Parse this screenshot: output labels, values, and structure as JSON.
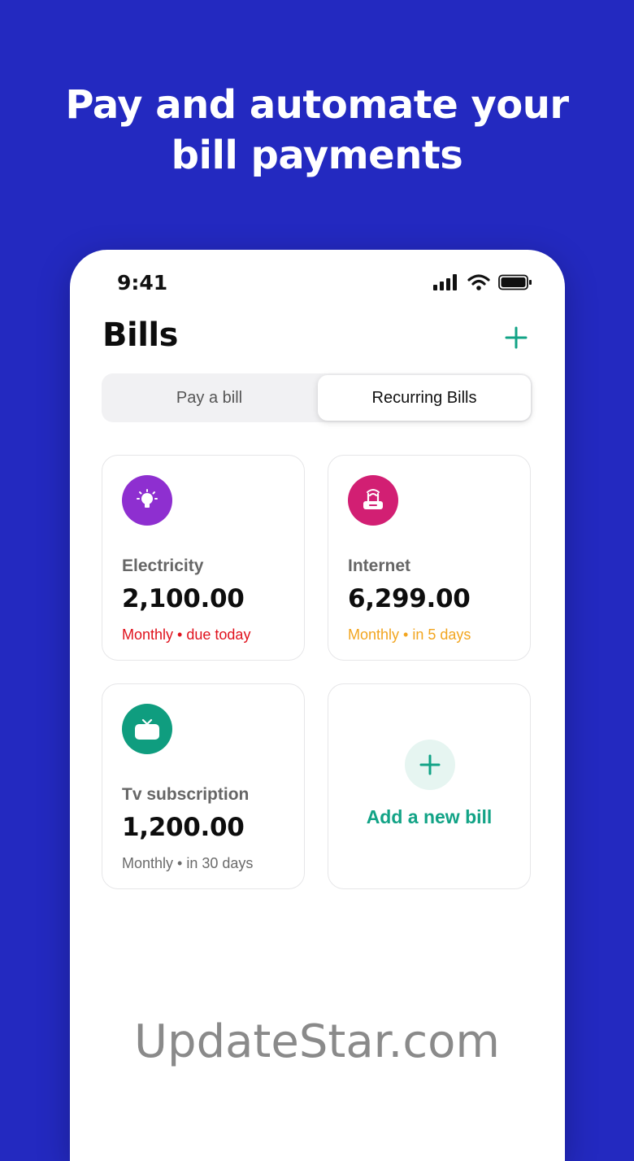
{
  "headline": {
    "line1": "Pay and automate your",
    "line2": "bill payments"
  },
  "status_bar": {
    "time": "9:41"
  },
  "screen": {
    "title": "Bills",
    "add_icon": "plus-icon",
    "tabs": [
      {
        "label": "Pay a bill",
        "selected": false
      },
      {
        "label": "Recurring Bills",
        "selected": true
      }
    ]
  },
  "bills": [
    {
      "name": "Electricity",
      "amount": "2,100.00",
      "frequency": "Monthly",
      "due": "due today",
      "status_color": "#e0121d",
      "icon": "lightbulb-icon",
      "icon_bg": "#8e2fd0"
    },
    {
      "name": "Internet",
      "amount": "6,299.00",
      "frequency": "Monthly",
      "due": "in 5 days",
      "status_color": "#f2a51f",
      "icon": "router-icon",
      "icon_bg": "#d21f73"
    },
    {
      "name": "Tv subscription",
      "amount": "1,200.00",
      "frequency": "Monthly",
      "due": "in 30 days",
      "status_color": "#6b6b6b",
      "icon": "tv-icon",
      "icon_bg": "#0f9d7f"
    }
  ],
  "add_bill": {
    "label": "Add a new bill",
    "icon": "plus-icon"
  },
  "watermark": "UpdateStar.com",
  "colors": {
    "background": "#2329c0",
    "accent": "#12a386"
  }
}
